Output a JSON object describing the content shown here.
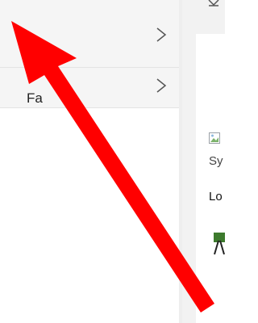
{
  "right_panel": {
    "heading": "Fa",
    "subheading": "Fa",
    "image_caption": "Sy",
    "label": "Lo"
  }
}
